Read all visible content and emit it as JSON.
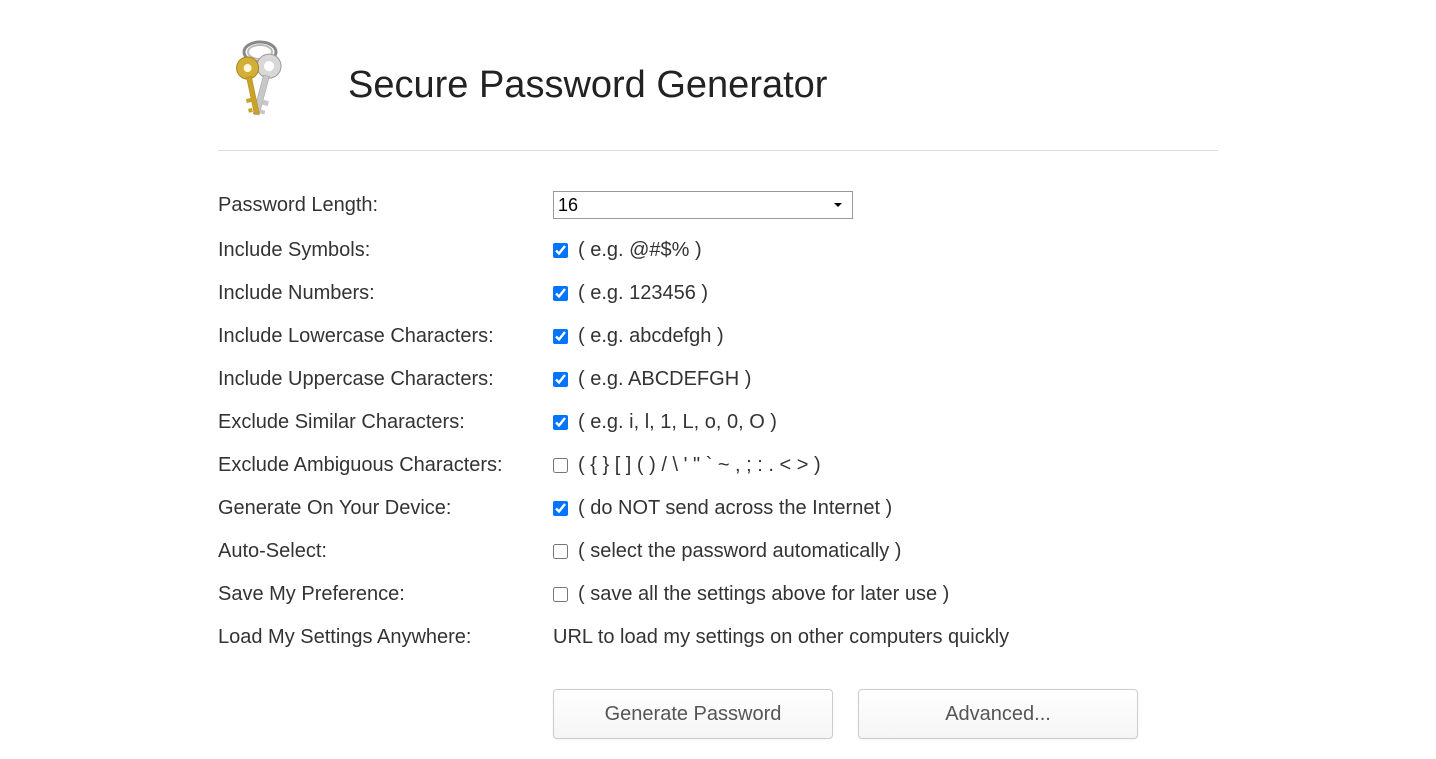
{
  "header": {
    "title": "Secure Password Generator"
  },
  "form": {
    "password_length": {
      "label": "Password Length:",
      "value": "16"
    },
    "include_symbols": {
      "label": "Include Symbols:",
      "checked": true,
      "hint": "( e.g. @#$% )"
    },
    "include_numbers": {
      "label": "Include Numbers:",
      "checked": true,
      "hint": "( e.g. 123456 )"
    },
    "include_lowercase": {
      "label": "Include Lowercase Characters:",
      "checked": true,
      "hint": "( e.g. abcdefgh )"
    },
    "include_uppercase": {
      "label": "Include Uppercase Characters:",
      "checked": true,
      "hint": "( e.g. ABCDEFGH )"
    },
    "exclude_similar": {
      "label": "Exclude Similar Characters:",
      "checked": true,
      "hint": "( e.g. i, l, 1, L, o, 0, O )"
    },
    "exclude_ambiguous": {
      "label": "Exclude Ambiguous Characters:",
      "checked": false,
      "hint": "( { } [ ] ( ) / \\ ' \" ` ~ , ; : . < > )"
    },
    "generate_local": {
      "label": "Generate On Your Device:",
      "checked": true,
      "hint": "( do NOT send across the Internet )"
    },
    "auto_select": {
      "label": "Auto-Select:",
      "checked": false,
      "hint": "( select the password automatically )"
    },
    "save_preference": {
      "label": "Save My Preference:",
      "checked": false,
      "hint": "( save all the settings above for later use )"
    },
    "load_settings": {
      "label": "Load My Settings Anywhere:",
      "link_text": "URL to load my settings on other computers quickly"
    }
  },
  "buttons": {
    "generate": "Generate Password",
    "advanced": "Advanced..."
  }
}
